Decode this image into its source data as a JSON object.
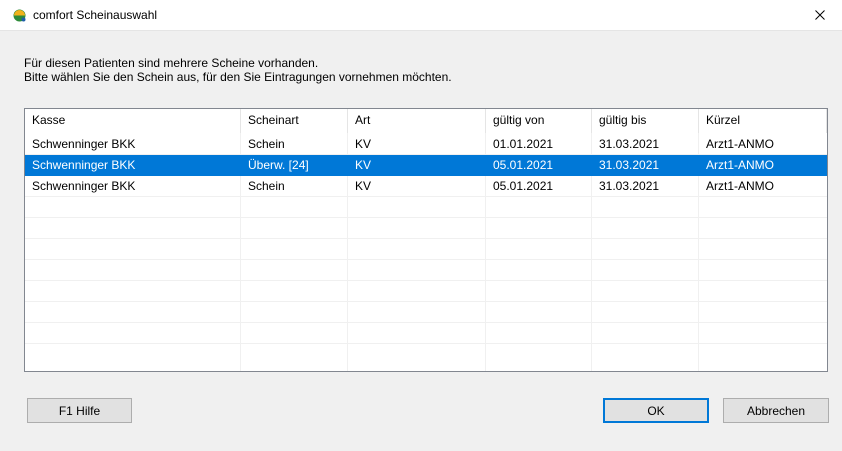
{
  "window": {
    "title": "comfort Scheinauswahl",
    "close_glyph": "×"
  },
  "instructions": {
    "line1": "Für diesen Patienten sind mehrere Scheine vorhanden.",
    "line2": "Bitte wählen Sie den Schein aus, für den Sie Eintragungen vornehmen möchten."
  },
  "table": {
    "columns": [
      "Kasse",
      "Scheinart",
      "Art",
      "gültig von",
      "gültig bis",
      "Kürzel"
    ],
    "rows": [
      [
        "Schwenninger BKK",
        "Schein",
        "KV",
        "01.01.2021",
        "31.03.2021",
        "Arzt1-ANMO"
      ],
      [
        "Schwenninger BKK",
        "Überw. [24]",
        "KV",
        "05.01.2021",
        "31.03.2021",
        "Arzt1-ANMO"
      ],
      [
        "Schwenninger BKK",
        "Schein",
        "KV",
        "05.01.2021",
        "31.03.2021",
        "Arzt1-ANMO"
      ]
    ],
    "selected_row": 2
  },
  "buttons": {
    "help": "F1 Hilfe",
    "ok": "OK",
    "cancel": "Abbrechen"
  },
  "colors": {
    "selection": "#0078d7",
    "default_button_border": "#0078d7"
  },
  "icons": {
    "app": "comfort-logo-icon",
    "close": "close-icon"
  }
}
